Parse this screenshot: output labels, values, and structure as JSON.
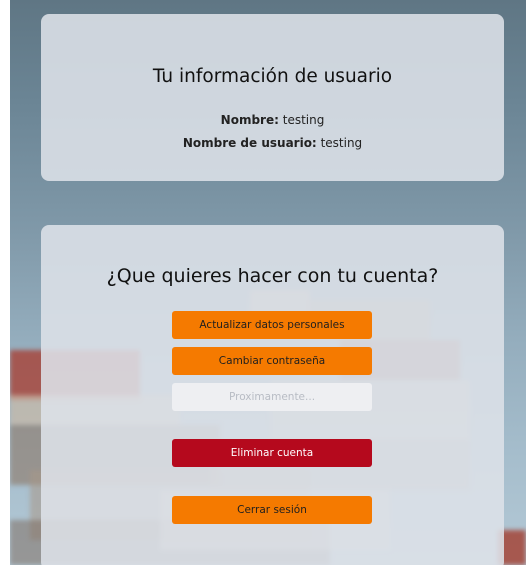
{
  "user_info": {
    "title": "Tu información de usuario",
    "name_label": "Nombre:",
    "name_value": "testing",
    "username_label": "Nombre de usuario:",
    "username_value": "testing"
  },
  "account_actions": {
    "title": "¿Que quieres hacer con tu cuenta?",
    "update_label": "Actualizar datos personales",
    "change_password_label": "Cambiar contraseña",
    "coming_soon_placeholder": "Proximamente...",
    "delete_label": "Eliminar cuenta",
    "logout_label": "Cerrar sesión"
  },
  "colors": {
    "primary_button": "#f57a00",
    "danger_button": "#b5091d",
    "card_background": "#dde1e8"
  }
}
